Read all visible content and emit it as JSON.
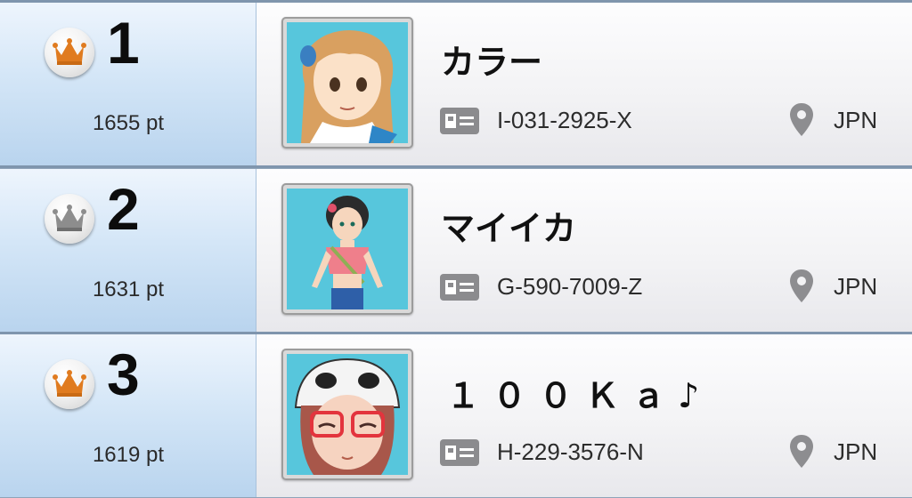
{
  "colors": {
    "crown_gold": "#e07b1f",
    "crown_silver": "#8d8d8d",
    "rank_panel": "#c9def3",
    "avatar_bg": "#57c6dc"
  },
  "leaderboard": [
    {
      "rank": "1",
      "points": "1655 pt",
      "medal": "gold-crown-icon",
      "name": "カラー",
      "trainer_id": "I-031-2925-X",
      "country": "JPN"
    },
    {
      "rank": "2",
      "points": "1631 pt",
      "medal": "silver-crown-icon",
      "name": "マイイカ",
      "trainer_id": "G-590-7009-Z",
      "country": "JPN"
    },
    {
      "rank": "3",
      "points": "1619 pt",
      "medal": "gold-crown-icon",
      "name": "１００Ｋａ♪",
      "trainer_id": "H-229-3576-N",
      "country": "JPN"
    }
  ]
}
